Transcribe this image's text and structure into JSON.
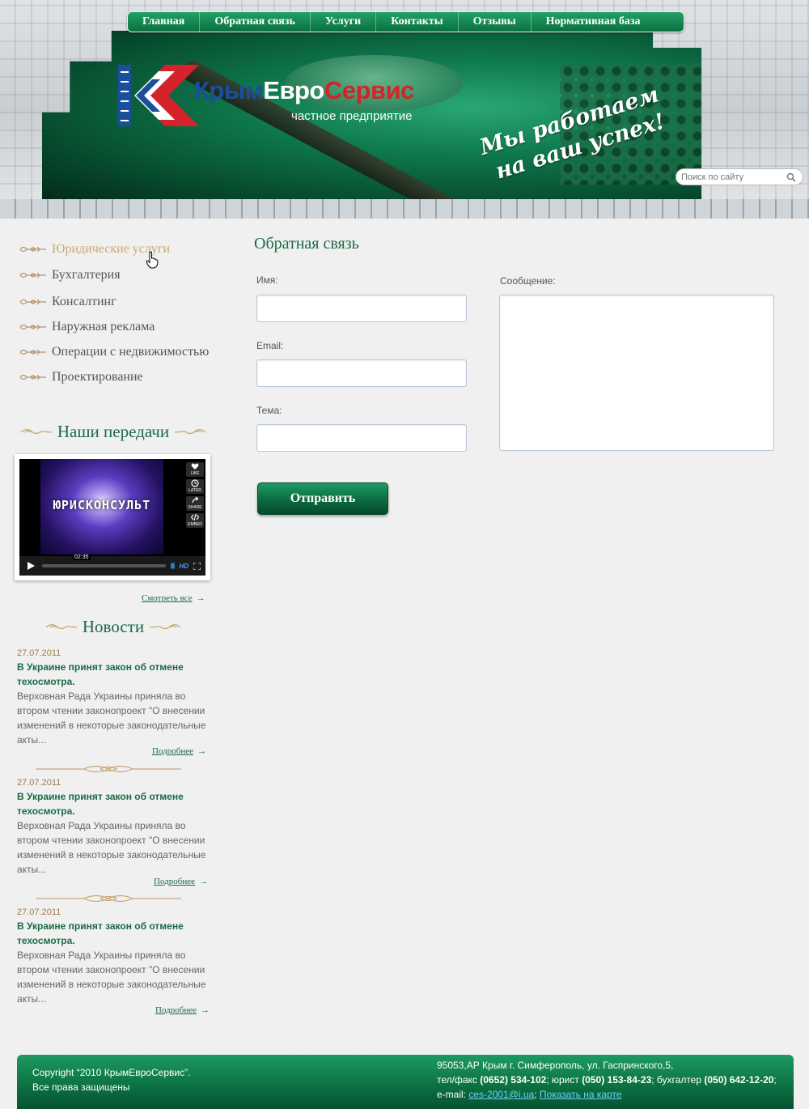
{
  "nav": {
    "items": [
      {
        "label": "Главная"
      },
      {
        "label": "Обратная связь"
      },
      {
        "label": "Услуги"
      },
      {
        "label": "Контакты"
      },
      {
        "label": "Отзывы"
      },
      {
        "label": "Нормативная база"
      }
    ]
  },
  "logo": {
    "name_part1": "Крым",
    "name_part2": "Евро",
    "name_part3": "Сервис",
    "subtitle": "частное предприятие"
  },
  "slogan": {
    "line1": "Мы работаем",
    "line2": "на ваш успех!"
  },
  "search": {
    "placeholder": "Поиск по сайту"
  },
  "sidebar": {
    "menu": [
      {
        "label": "Юридические услуги",
        "active": true
      },
      {
        "label": "Бухгалтерия"
      },
      {
        "label": "Консалтинг"
      },
      {
        "label": "Наружная реклама"
      },
      {
        "label": "Операции с недвижимостью"
      },
      {
        "label": "Проектирование"
      }
    ],
    "shows_title": "Наши передачи",
    "video": {
      "title": "ЮРИСКОНСУЛЬТ",
      "time": "02:35",
      "quality": "HD",
      "side_buttons": [
        "LIKE",
        "LATER",
        "SHARE",
        "EMBED"
      ]
    },
    "watch_all": "Смотреть все",
    "news_title": "Новости",
    "news": [
      {
        "date": "27.07.2011",
        "title": "В Украине принят закон об отмене техосмотра.",
        "text": "Верховная Рада Украины приняла во втором чтении законопроект \"О внесении изменений в некоторые законодательные акты...",
        "more": "Подробнее"
      },
      {
        "date": "27.07.2011",
        "title": "В Украине принят закон об отмене техосмотра.",
        "text": "Верховная Рада Украины приняла во втором чтении законопроект \"О внесении изменений в некоторые законодательные акты...",
        "more": "Подробнее"
      },
      {
        "date": "27.07.2011",
        "title": "В Украине принят закон об отмене техосмотра.",
        "text": "Верховная Рада Украины приняла во втором чтении законопроект \"О внесении изменений в некоторые законодательные акты...",
        "more": "Подробнее"
      }
    ]
  },
  "form": {
    "title": "Обратная связь",
    "name_label": "Имя:",
    "email_label": "Email:",
    "subject_label": "Тема:",
    "message_label": "Сообщение:",
    "name_value": "",
    "email_value": "",
    "subject_value": "",
    "message_value": "",
    "submit_label": "Отправить"
  },
  "footer": {
    "copyright": "Copyright “2010 КрымЕвроСервис”.",
    "rights": "Все права защищены",
    "address": "95053,АР Крым г. Симферополь, ул. Гаспринского,5,",
    "phone_prefix": "тел/факс ",
    "phone_main": "(0652) 534-102",
    "lawyer_prefix": "; юрист ",
    "phone_lawyer": "(050) 153-84-23",
    "accountant_prefix": "; бухгалтер ",
    "phone_accountant": "(050) 642-12-20",
    "end_sep": ";",
    "email_prefix": "e-mail: ",
    "email": "ces-2001@i.ua",
    "sep": "; ",
    "map_link": "Показать на карте"
  },
  "colors": {
    "brand_green": "#0b6f40",
    "accent_gold": "#c8a877",
    "title_green": "#1a6b45",
    "logo_blue": "#1b4f9c",
    "logo_red": "#d4232a"
  },
  "icons": {
    "search": "search-icon",
    "menu_bullet": "ornament-icon",
    "play": "play-icon",
    "cursor": "hand-cursor-icon"
  }
}
